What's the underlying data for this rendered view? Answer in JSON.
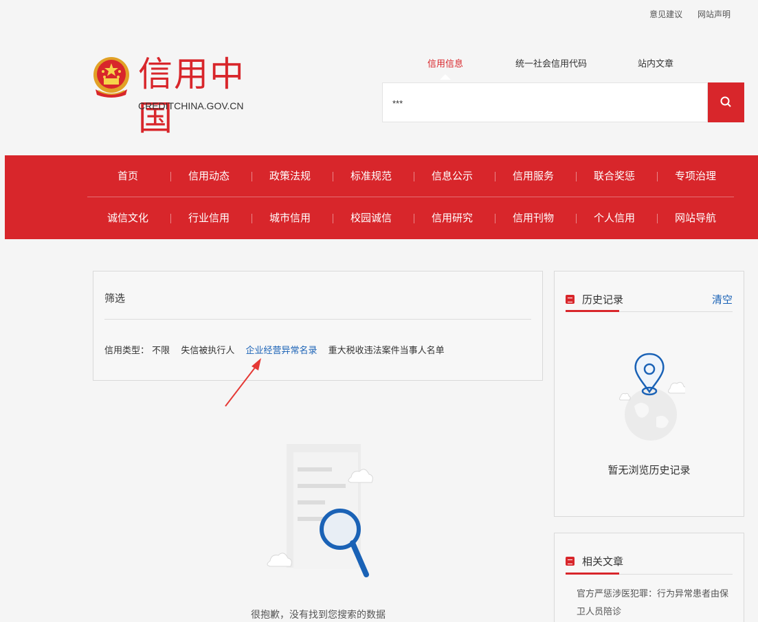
{
  "top_links": {
    "feedback": "意见建议",
    "statement": "网站声明"
  },
  "logo": {
    "title": "信用中国",
    "subtitle": "CREDITCHINA.GOV.CN"
  },
  "search": {
    "tabs": [
      "信用信息",
      "统一社会信用代码",
      "站内文章"
    ],
    "active_tab": "信用信息",
    "value": "***"
  },
  "nav": {
    "row1": [
      "首页",
      "信用动态",
      "政策法规",
      "标准规范",
      "信息公示",
      "信用服务",
      "联合奖惩",
      "专项治理"
    ],
    "row2": [
      "诚信文化",
      "行业信用",
      "城市信用",
      "校园诚信",
      "信用研究",
      "信用刊物",
      "个人信用",
      "网站导航"
    ]
  },
  "filter": {
    "title": "筛选",
    "label": "信用类型：",
    "options": [
      "不限",
      "失信被执行人",
      "企业经营异常名录",
      "重大税收违法案件当事人名单"
    ],
    "active_option": "企业经营异常名录"
  },
  "empty_state": {
    "text": "很抱歉，没有找到您搜索的数据"
  },
  "history": {
    "title": "历史记录",
    "clear": "清空",
    "empty_text": "暂无浏览历史记录"
  },
  "related": {
    "title": "相关文章",
    "article": "官方严惩涉医犯罪：行为异常患者由保卫人员陪诊"
  },
  "colors": {
    "brand_red": "#d8262b",
    "link_blue": "#1a62b6",
    "annotation_red": "#e53935"
  },
  "icons": {
    "search": "search-icon",
    "emblem": "national-emblem-icon",
    "panel": "panel-header-icon",
    "location": "location-pin-icon",
    "magnifier": "magnifier-icon"
  }
}
